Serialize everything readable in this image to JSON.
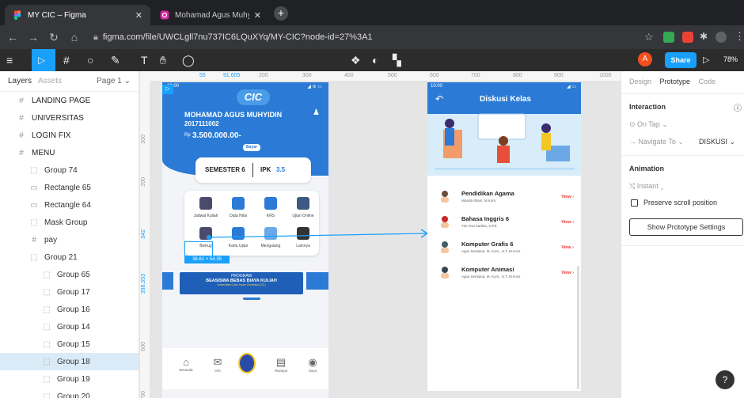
{
  "browser": {
    "tabs": [
      {
        "title": "MY CIC – Figma",
        "active": true
      },
      {
        "title": "Mohamad Agus Muhyidin (@mu",
        "active": false
      }
    ],
    "url": "figma.com/file/UWCLgll7nu737IC6LQuXYq/MY-CIC?node-id=27%3A1"
  },
  "toolbar": {
    "avatar": "A",
    "share": "Share",
    "zoom": "78%"
  },
  "layers": {
    "tabs": [
      "Layers",
      "Assets"
    ],
    "page": "Page 1",
    "items": [
      {
        "label": "LANDING PAGE",
        "icon": "frame-icon",
        "depth": 0,
        "bold": true
      },
      {
        "label": "UNIVERSITAS",
        "icon": "frame-icon",
        "depth": 0,
        "bold": true
      },
      {
        "label": "LOGIN FIX",
        "icon": "frame-icon",
        "depth": 0,
        "bold": true
      },
      {
        "label": "MENU",
        "icon": "frame-icon",
        "depth": 0,
        "bold": true
      },
      {
        "label": "Group 74",
        "icon": "group-icon",
        "depth": 1
      },
      {
        "label": "Rectangle 65",
        "icon": "rectangle-icon",
        "depth": 1
      },
      {
        "label": "Rectangle 64",
        "icon": "rectangle-icon",
        "depth": 1
      },
      {
        "label": "Mask Group",
        "icon": "group-icon",
        "depth": 1
      },
      {
        "label": "pay",
        "icon": "frame-icon",
        "depth": 1
      },
      {
        "label": "Group 21",
        "icon": "group-icon",
        "depth": 1
      },
      {
        "label": "Group 65",
        "icon": "group-icon",
        "depth": 2
      },
      {
        "label": "Group 17",
        "icon": "group-icon",
        "depth": 2
      },
      {
        "label": "Group 16",
        "icon": "group-icon",
        "depth": 2
      },
      {
        "label": "Group 14",
        "icon": "group-icon",
        "depth": 2
      },
      {
        "label": "Group 15",
        "icon": "group-icon",
        "depth": 2
      },
      {
        "label": "Group 18",
        "icon": "group-icon",
        "depth": 2,
        "selected": true
      },
      {
        "label": "Group 19",
        "icon": "group-icon",
        "depth": 2
      },
      {
        "label": "Group 20",
        "icon": "group-icon",
        "depth": 2
      }
    ]
  },
  "rulers": {
    "top": [
      "55",
      "91.605",
      "200",
      "300",
      "400",
      "500",
      "600",
      "700",
      "800",
      "900",
      "1000"
    ],
    "left": [
      "300",
      "200",
      "342",
      "398.353",
      "600",
      "700"
    ]
  },
  "screen1": {
    "time": "10:00",
    "logo": "CIC",
    "name": "MOHAMAD AGUS MUHYIDIN",
    "nim": "2017111002",
    "balance": "3.500.000.00-",
    "currency": "Rp",
    "pay": "Bayar",
    "semester": "SEMESTER 6",
    "ipk_label": "IPK",
    "ipk_value": "3.5",
    "menu": [
      "Jadwal Kuliah",
      "Data Nilai",
      "KRS",
      "Ujian Online",
      "Belnug",
      "Kartu Ujian",
      "Mengulang",
      "Lainnya"
    ],
    "selection_size": "36.61 × 54.35",
    "banner_title": "PROGRAM",
    "banner_line": "BEASISWA BEBAS BIAYA KULIAH",
    "banner_sub": "Universitas Catur Insan Cendekia (CIC)",
    "bottom_nav": [
      "Beranda",
      "Info",
      "",
      "Riwayat",
      "Saya"
    ]
  },
  "screen2": {
    "time": "10:00",
    "title": "Diskusi Kelas",
    "courses": [
      {
        "name": "Pendidikan Agama",
        "lecturer": "Wanda Ilham, M.Kom.",
        "action": "View"
      },
      {
        "name": "Bahasa Inggris 6",
        "lecturer": "Yier Dwi Kartika, S.Pd.",
        "action": "View"
      },
      {
        "name": "Komputer Grafis 6",
        "lecturer": "Agus Sentiana, M. Kom., S.T.,M.Kom.",
        "action": "View"
      },
      {
        "name": "Komputer Animasi",
        "lecturer": "Agus Sentiana, M. Kom., S.T.,M.Kom.",
        "action": "View"
      }
    ]
  },
  "inspector": {
    "tabs": [
      "Design",
      "Prototype",
      "Code"
    ],
    "interaction": "Interaction",
    "trigger": "On Tap",
    "action": "Navigate To",
    "destination": "DISKUSI",
    "animation": "Animation",
    "anim_type": "Instant",
    "preserve": "Preserve scroll position",
    "show_settings": "Show Prototype Settings"
  },
  "colors": {
    "accent": "#18a0fb",
    "phone_blue": "#2b7bd6",
    "view_red": "#e53935",
    "selection": "#daebf7"
  }
}
